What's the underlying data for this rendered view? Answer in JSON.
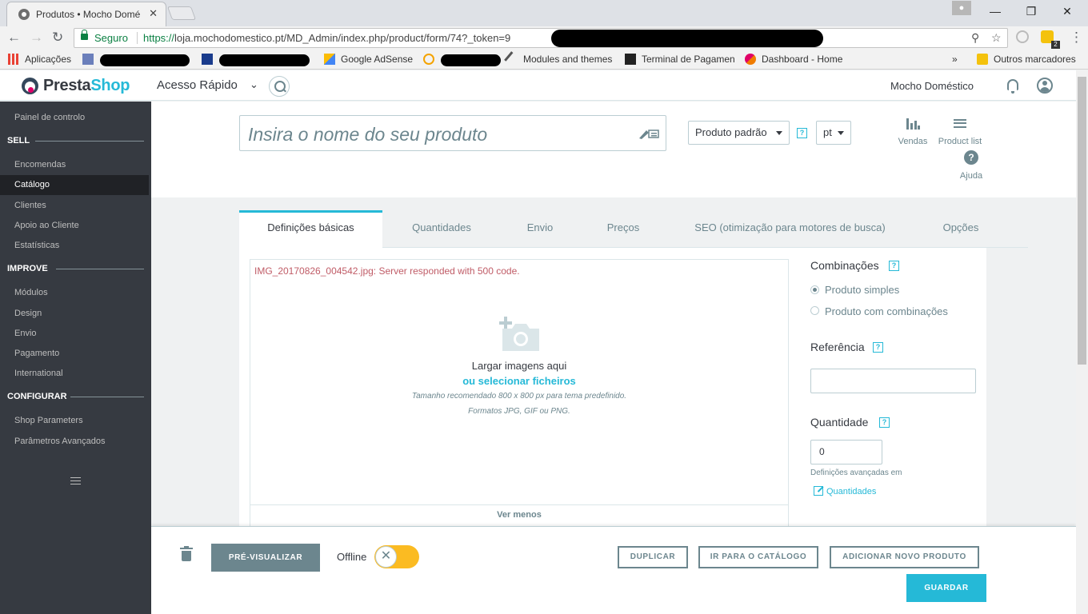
{
  "browser": {
    "tab_title": "Produtos • Mocho Domé",
    "tab_close": "✕",
    "secure_label": "Seguro",
    "url_scheme": "https://",
    "url_rest": "loja.mochodomestico.pt/MD_Admin/index.php/product/form/74?_token=9",
    "extension_badge": "2",
    "nav_back": "←",
    "nav_forward": "→",
    "nav_reload": "↻",
    "zoom_icon": "⚲",
    "star_icon": "☆",
    "menu_icon": "⋮",
    "win_min": "—",
    "win_max": "❐",
    "win_close": "✕",
    "bookmarks_overflow": "»",
    "bookmarks": [
      "Aplicações",
      "Google AdSense",
      "Modules and themes",
      "Terminal de Pagamen",
      "Dashboard - Home",
      "Outros marcadores"
    ]
  },
  "header": {
    "logo_presta": "Presta",
    "logo_shop": "Shop",
    "quick_access": "Acesso Rápido",
    "quick_access_chevron": "⌄",
    "shop_name": "Mocho Doméstico"
  },
  "sidebar": {
    "dashboard": "Painel de controlo",
    "sections": {
      "sell": "SELL",
      "improve": "IMPROVE",
      "configure": "CONFIGURAR"
    },
    "sell_items": [
      "Encomendas",
      "Catálogo",
      "Clientes",
      "Apoio ao Cliente",
      "Estatísticas"
    ],
    "improve_items": [
      "Módulos",
      "Design",
      "Envio",
      "Pagamento",
      "International"
    ],
    "configure_items": [
      "Shop Parameters",
      "Parâmetros Avançados"
    ]
  },
  "product_header": {
    "name_placeholder": "Insira o nome do seu produto",
    "product_type": "Produto padrão",
    "help": "?",
    "language": "pt",
    "actions": {
      "sales": "Vendas",
      "product_list": "Product list",
      "help": "Ajuda"
    }
  },
  "tabs": [
    "Definições básicas",
    "Quantidades",
    "Envio",
    "Preços",
    "SEO (otimização para motores de busca)",
    "Opções"
  ],
  "dropzone": {
    "error": "IMG_20170826_004542.jpg: Server responded with 500 code.",
    "drop_text": "Largar imagens aqui",
    "select_text": "ou selecionar ficheiros",
    "hint_size": "Tamanho recomendado 800 x 800 px para tema predefinido.",
    "hint_formats": "Formatos JPG, GIF ou PNG.",
    "show_less": "Ver menos"
  },
  "right_column": {
    "combinations_title": "Combinações",
    "simple_product": "Produto simples",
    "with_combinations": "Produto com combinações",
    "reference_title": "Referência",
    "reference_value": "",
    "quantity_title": "Quantidade",
    "quantity_value": "0",
    "advanced_note": "Definições avançadas em",
    "quantities_link": "Quantidades"
  },
  "footer": {
    "preview": "PRÉ-VISUALIZAR",
    "status_label": "Offline",
    "toggle_off_glyph": "✕",
    "duplicate": "DUPLICAR",
    "go_to_catalog": "IR PARA O CATÁLOGO",
    "add_new": "ADICIONAR NOVO PRODUTO",
    "save": "GUARDAR"
  },
  "colors": {
    "accent": "#25b9d7",
    "sidebar": "#363a41",
    "toggle_off": "#fbbb22",
    "error": "#c05c67"
  }
}
